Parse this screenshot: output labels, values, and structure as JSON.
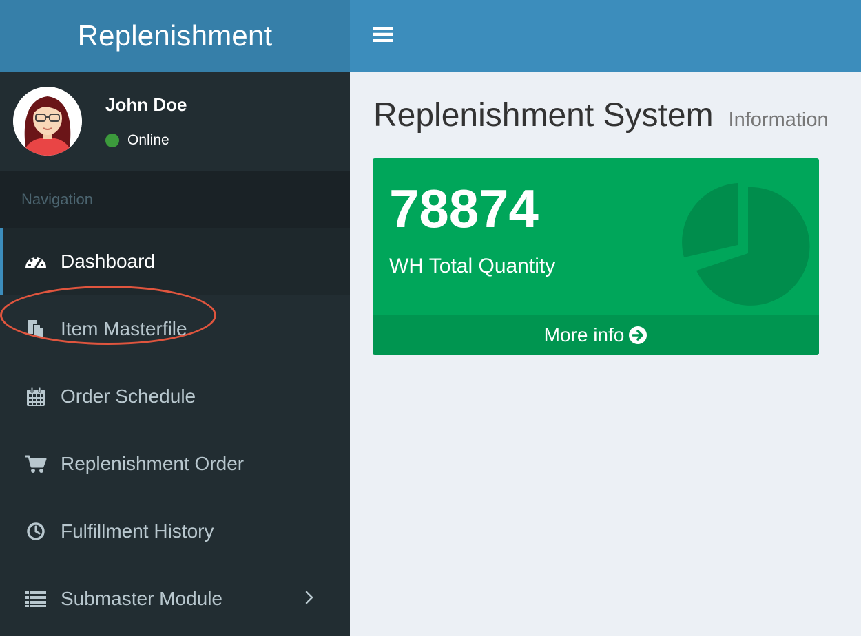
{
  "app": {
    "logo_text": "Replenishment"
  },
  "user": {
    "name": "John Doe",
    "status": "Online"
  },
  "sidebar": {
    "header": "Navigation",
    "items": [
      {
        "label": "Dashboard",
        "icon": "dashboard-icon",
        "active": true
      },
      {
        "label": "Item Masterfile",
        "icon": "copy-file-icon",
        "highlighted": true
      },
      {
        "label": "Order Schedule",
        "icon": "calendar-icon"
      },
      {
        "label": "Replenishment Order",
        "icon": "cart-icon"
      },
      {
        "label": "Fulfillment History",
        "icon": "clock-icon"
      },
      {
        "label": "Submaster Module",
        "icon": "list-icon",
        "has_submenu": true
      }
    ]
  },
  "content": {
    "title": "Replenishment System",
    "subtitle": "Information",
    "stat_box": {
      "value": "78874",
      "label": "WH Total Quantity",
      "footer": "More info",
      "color": "#00a65a",
      "icon": "pie-chart-icon"
    }
  },
  "colors": {
    "header": "#3c8dbc",
    "logo_bg": "#367fa9",
    "sidebar": "#222d32",
    "highlight": "#e0553e"
  }
}
